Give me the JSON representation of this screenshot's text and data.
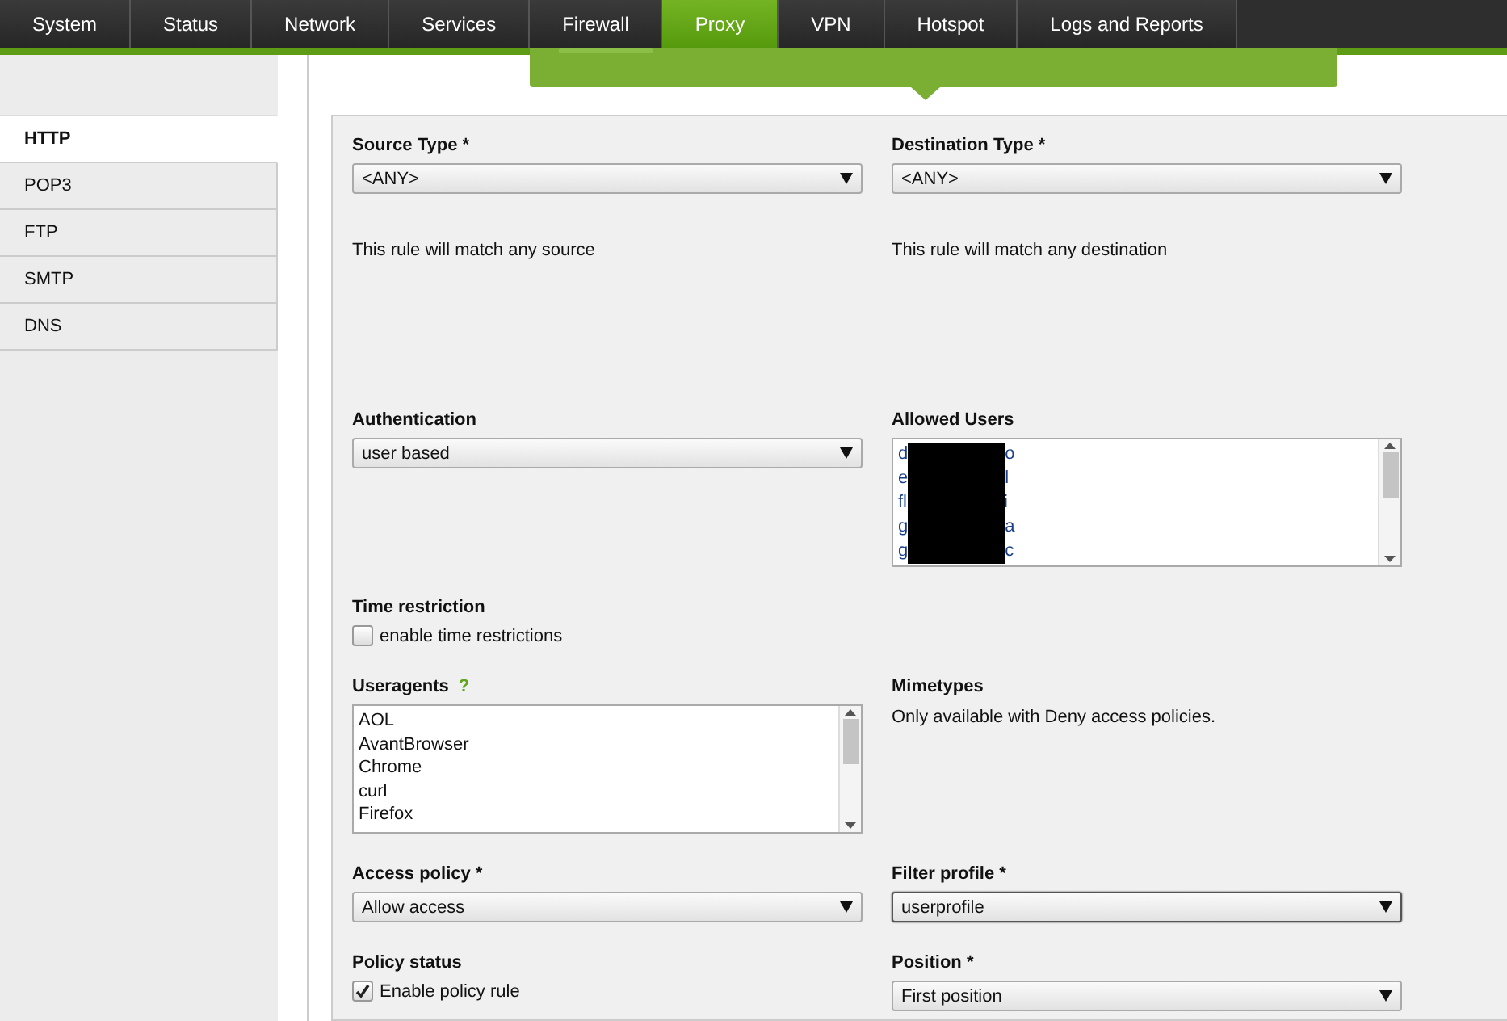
{
  "nav_tabs": [
    {
      "label": "System",
      "selected": false
    },
    {
      "label": "Status",
      "selected": false
    },
    {
      "label": "Network",
      "selected": false
    },
    {
      "label": "Services",
      "selected": false
    },
    {
      "label": "Firewall",
      "selected": false
    },
    {
      "label": "Proxy",
      "selected": true
    },
    {
      "label": "VPN",
      "selected": false
    },
    {
      "label": "Hotspot",
      "selected": false
    },
    {
      "label": "Logs and Reports",
      "selected": false
    }
  ],
  "sidebar": {
    "items": [
      {
        "label": "HTTP",
        "selected": true
      },
      {
        "label": "POP3",
        "selected": false
      },
      {
        "label": "FTP",
        "selected": false
      },
      {
        "label": "SMTP",
        "selected": false
      },
      {
        "label": "DNS",
        "selected": false
      }
    ]
  },
  "form": {
    "rows": [
      [
        {
          "kind": "select",
          "label": "Source Type *",
          "value": "<ANY>",
          "focused": false
        },
        {
          "kind": "select",
          "label": "Destination Type *",
          "value": "<ANY>",
          "focused": false
        }
      ],
      [
        {
          "kind": "note",
          "text": "This rule will match any source"
        },
        {
          "kind": "note",
          "text": "This rule will match any destination"
        }
      ],
      [
        {
          "kind": "select",
          "label": "Authentication",
          "value": "user based",
          "focused": false
        },
        {
          "kind": "listbox",
          "label": "Allowed Users",
          "items": [
            {
              "start": "d",
              "end": "o",
              "redacted": true
            },
            {
              "start": "e",
              "end": "l",
              "redacted": true
            },
            {
              "start": "fl",
              "end": "i",
              "redacted": true
            },
            {
              "start": "g",
              "end": "a",
              "redacted": true
            },
            {
              "start": "g",
              "end": "c",
              "redacted": true
            }
          ]
        }
      ],
      [
        {
          "kind": "checkbox",
          "label": "Time restriction",
          "text": "enable time restrictions",
          "checked": false
        }
      ],
      [
        {
          "kind": "listbox",
          "label": "Useragents",
          "help": "?",
          "items": [
            {
              "start": "AOL",
              "redacted": false
            },
            {
              "start": "AvantBrowser",
              "redacted": false
            },
            {
              "start": "Chrome",
              "redacted": false
            },
            {
              "start": "curl",
              "redacted": false
            },
            {
              "start": "Firefox",
              "redacted": false
            }
          ]
        },
        {
          "kind": "labelnote",
          "label": "Mimetypes",
          "text": "Only available with Deny access policies."
        }
      ],
      [
        {
          "kind": "select",
          "label": "Access policy *",
          "value": "Allow access",
          "focused": false
        },
        {
          "kind": "select",
          "label": "Filter profile *",
          "value": "userprofile",
          "focused": true
        }
      ],
      [
        {
          "kind": "checkbox",
          "label": "Policy status",
          "text": "Enable policy rule",
          "checked": true
        },
        {
          "kind": "select",
          "label": "Position *",
          "value": "First position",
          "focused": false
        }
      ]
    ]
  }
}
